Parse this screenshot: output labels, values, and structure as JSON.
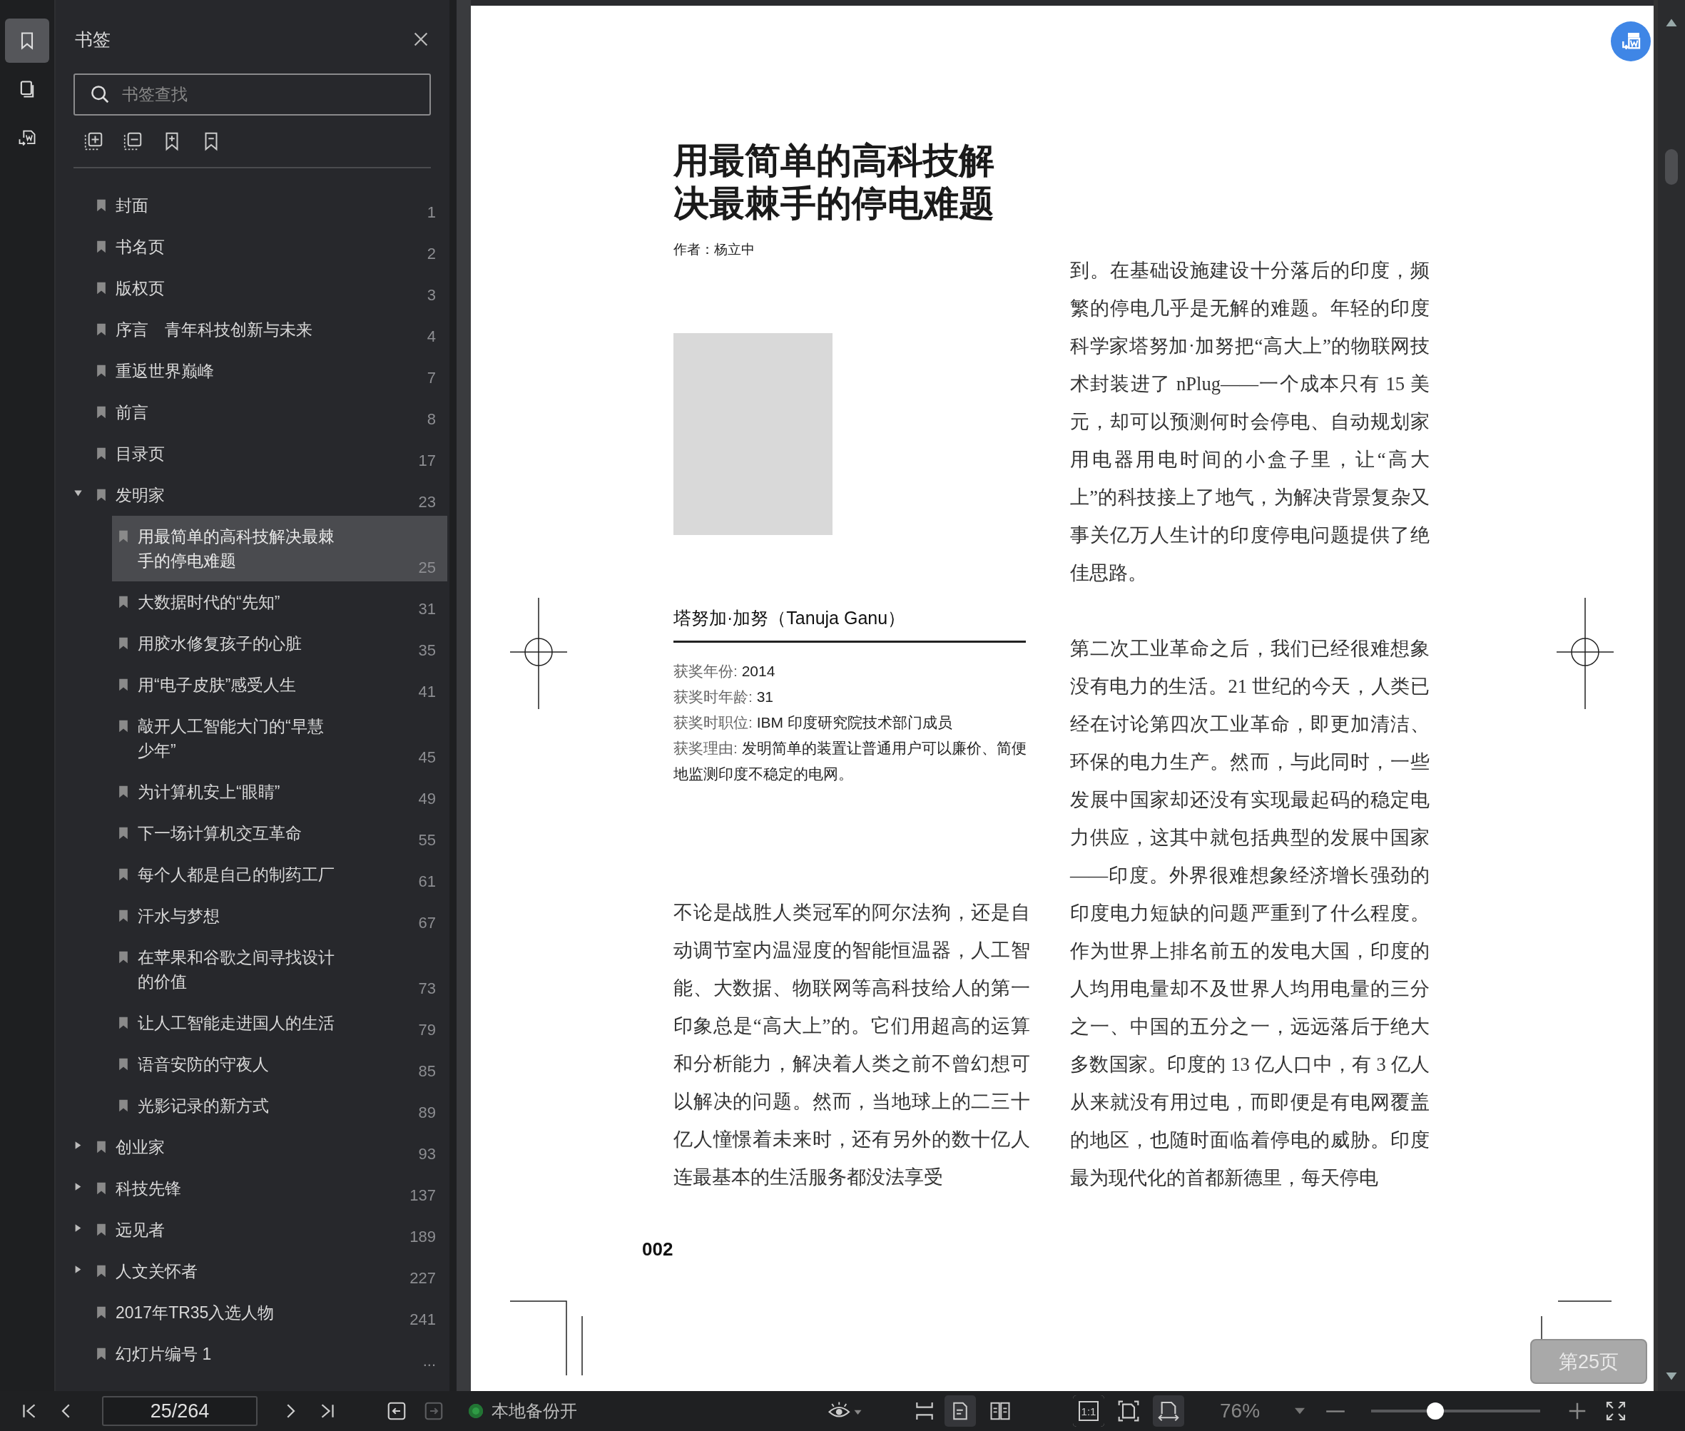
{
  "rail": {
    "tabs": [
      {
        "kind": "bookmarks",
        "selected": true
      },
      {
        "kind": "thumbnails",
        "selected": false
      },
      {
        "kind": "convert",
        "selected": false
      }
    ]
  },
  "sidebar": {
    "title": "书签",
    "search": {
      "placeholder": "书签查找"
    },
    "items": [
      {
        "title": "封面",
        "page": "1",
        "selected": false
      },
      {
        "title": "书名页",
        "page": "2",
        "selected": false
      },
      {
        "title": "版权页",
        "page": "3",
        "selected": false
      },
      {
        "title": "序言　青年科技创新与未来",
        "page": "4",
        "selected": false
      },
      {
        "title": "重返世界巅峰",
        "page": "7",
        "selected": false
      },
      {
        "title": "前言",
        "page": "8",
        "selected": false
      },
      {
        "title": "目录页",
        "page": "17",
        "selected": false
      },
      {
        "title": "发明家",
        "page": "23",
        "selected": false,
        "expanded": true,
        "children": [
          {
            "title": "用最简单的高科技解决最棘手的停电难题",
            "page": "25",
            "selected": true
          },
          {
            "title": "大数据时代的“先知”",
            "page": "31",
            "selected": false
          },
          {
            "title": "用胶水修复孩子的心脏",
            "page": "35",
            "selected": false
          },
          {
            "title": "用“电子皮肤”感受人生",
            "page": "41",
            "selected": false
          },
          {
            "title": "敲开人工智能大门的“早慧少年”",
            "page": "45",
            "selected": false
          },
          {
            "title": "为计算机安上“眼睛”",
            "page": "49",
            "selected": false
          },
          {
            "title": "下一场计算机交互革命",
            "page": "55",
            "selected": false
          },
          {
            "title": "每个人都是自己的制药工厂",
            "page": "61",
            "selected": false
          },
          {
            "title": "汗水与梦想",
            "page": "67",
            "selected": false
          },
          {
            "title": "在苹果和谷歌之间寻找设计的价值",
            "page": "73",
            "selected": false
          },
          {
            "title": "让人工智能走进国人的生活",
            "page": "79",
            "selected": false
          },
          {
            "title": "语音安防的守夜人",
            "page": "85",
            "selected": false
          },
          {
            "title": "光影记录的新方式",
            "page": "89",
            "selected": false
          }
        ]
      },
      {
        "title": "创业家",
        "page": "93",
        "selected": false,
        "expanded": false
      },
      {
        "title": "科技先锋",
        "page": "137",
        "selected": false,
        "expanded": false
      },
      {
        "title": "远见者",
        "page": "189",
        "selected": false,
        "expanded": false
      },
      {
        "title": "人文关怀者",
        "page": "227",
        "selected": false,
        "expanded": false
      },
      {
        "title": "2017年TR35入选人物",
        "page": "241",
        "selected": false
      },
      {
        "title": "幻灯片编号 1",
        "page": "...",
        "selected": false
      }
    ]
  },
  "page": {
    "title": "用最简单的高科技解决最棘手的停电难题",
    "author": "作者：杨立中",
    "name": "塔努加·加努（Tanuja Ganu）",
    "facts": [
      {
        "label": "获奖年份:",
        "value": "2014"
      },
      {
        "label": "获奖时年龄:",
        "value": "31"
      },
      {
        "label": "获奖时职位:",
        "value": "IBM 印度研究院技术部门成员"
      },
      {
        "label": "获奖理由:",
        "value": "发明简单的装置让普通用户可以廉价、简便地监测印度不稳定的电网。"
      }
    ],
    "left_paragraphs": [
      "不论是战胜人类冠军的阿尔法狗，还是自动调节室内温湿度的智能恒温器，人工智能、大数据、物联网等高科技给人的第一印象总是“高大上”的。它们用超高的运算和分析能力，解决着人类之前不曾幻想可以解决的问题。然而，当地球上的二三十亿人憧憬着未来时，还有另外的数十亿人连最基本的生活服务都没法享受"
    ],
    "right_paragraphs": [
      "到。在基础设施建设十分落后的印度，频繁的停电几乎是无解的难题。年轻的印度科学家塔努加·加努把“高大上”的物联网技术封装进了 nPlug——一个成本只有 15 美元，却可以预测何时会停电、自动规划家用电器用电时间的小盒子里，让“高大上”的科技接上了地气，为解决背景复杂又事关亿万人生计的印度停电问题提供了绝佳思路。",
      "第二次工业革命之后，我们已经很难想象没有电力的生活。21 世纪的今天，人类已经在讨论第四次工业革命，即更加清洁、环保的电力生产。然而，与此同时，一些发展中国家却还没有实现最起码的稳定电力供应，这其中就包括典型的发展中国家——印度。外界很难想象经济增长强劲的印度电力短缺的问题严重到了什么程度。作为世界上排名前五的发电大国，印度的人均用电量却不及世界人均用电量的三分之一、中国的五分之一，远远落后于绝大多数国家。印度的 13 亿人口中，有 3 亿人从来就没有用过电，而即便是有电网覆盖的地区，也随时面临着停电的威胁。印度最为现代化的首都新德里，每天停电"
    ],
    "page_number": "002",
    "page_badge": "第25页"
  },
  "toolbar": {
    "page_field": "25/264",
    "history": [
      {
        "kind": "back",
        "disabled": false
      },
      {
        "kind": "forward",
        "disabled": true
      }
    ],
    "backup": {
      "label": "本地备份开",
      "on": true
    },
    "view_modes": [
      {
        "kind": "single",
        "selected": true
      },
      {
        "kind": "double",
        "selected": false
      }
    ],
    "fit_modes": [
      {
        "kind": "actual",
        "label": "1:1",
        "selected": false
      },
      {
        "kind": "page",
        "selected": false
      },
      {
        "kind": "width",
        "selected": true
      }
    ],
    "zoom": {
      "value": "76%",
      "level": 0.38
    }
  }
}
